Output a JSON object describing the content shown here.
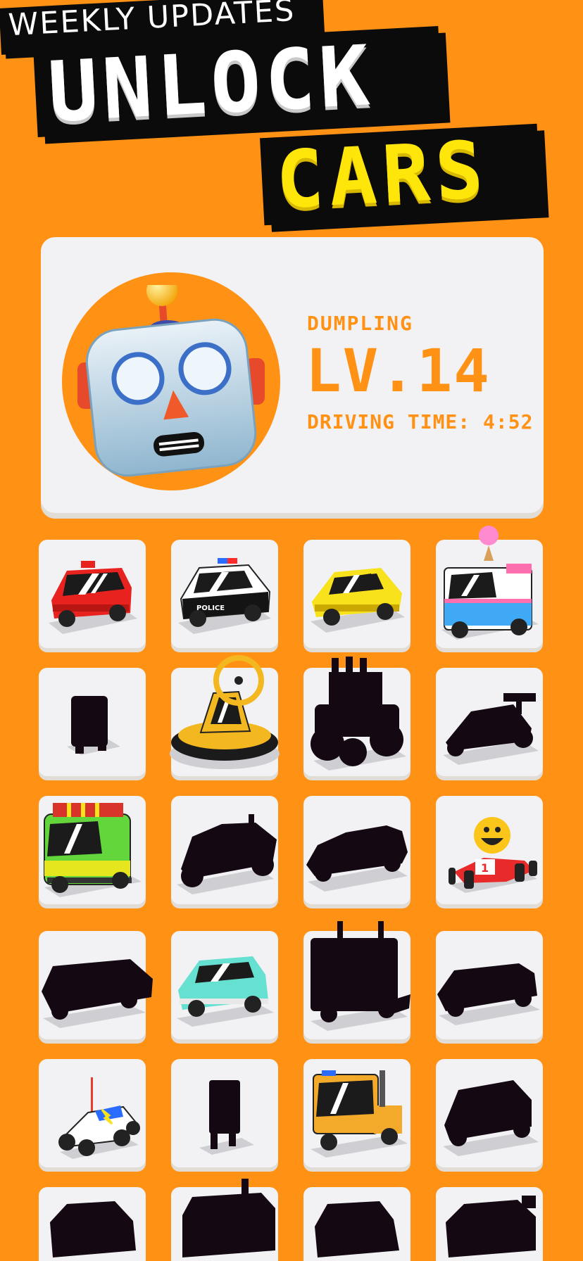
{
  "title": {
    "line1": "UNLOCK",
    "line2": "CARS",
    "subtitle": "WEEKLY UPDATES"
  },
  "profile": {
    "name": "DUMPLING",
    "level": "LV.14",
    "driving_time": "DRIVING TIME: 4:52",
    "avatar_icon": "robot-face-icon"
  },
  "colors": {
    "background": "#ff9214",
    "accent_yellow": "#ffe60a",
    "card": "#f2f2f4",
    "silhouette": "#140812"
  },
  "cars": [
    {
      "id": "red-hatchback",
      "unlocked": true
    },
    {
      "id": "police-car",
      "unlocked": true
    },
    {
      "id": "yellow-muscle-car",
      "unlocked": true
    },
    {
      "id": "ice-cream-van",
      "unlocked": true
    },
    {
      "id": "mini-upright",
      "unlocked": false
    },
    {
      "id": "hovercraft",
      "unlocked": true
    },
    {
      "id": "monster-truck",
      "unlocked": false
    },
    {
      "id": "formula-racer",
      "unlocked": false
    },
    {
      "id": "jungle-bus",
      "unlocked": true
    },
    {
      "id": "rally-buggy",
      "unlocked": false
    },
    {
      "id": "sports-coupe",
      "unlocked": false
    },
    {
      "id": "smiley-kart",
      "unlocked": true
    },
    {
      "id": "armored-truck",
      "unlocked": false
    },
    {
      "id": "retro-sedan",
      "unlocked": true
    },
    {
      "id": "big-rig",
      "unlocked": false
    },
    {
      "id": "suv",
      "unlocked": false
    },
    {
      "id": "rc-buggy",
      "unlocked": true
    },
    {
      "id": "walker",
      "unlocked": false
    },
    {
      "id": "tow-truck",
      "unlocked": true
    },
    {
      "id": "compact-car",
      "unlocked": false
    },
    {
      "id": "beetle",
      "unlocked": false
    },
    {
      "id": "tall-truck",
      "unlocked": false
    },
    {
      "id": "hatch",
      "unlocked": false
    },
    {
      "id": "jeep",
      "unlocked": false
    }
  ]
}
